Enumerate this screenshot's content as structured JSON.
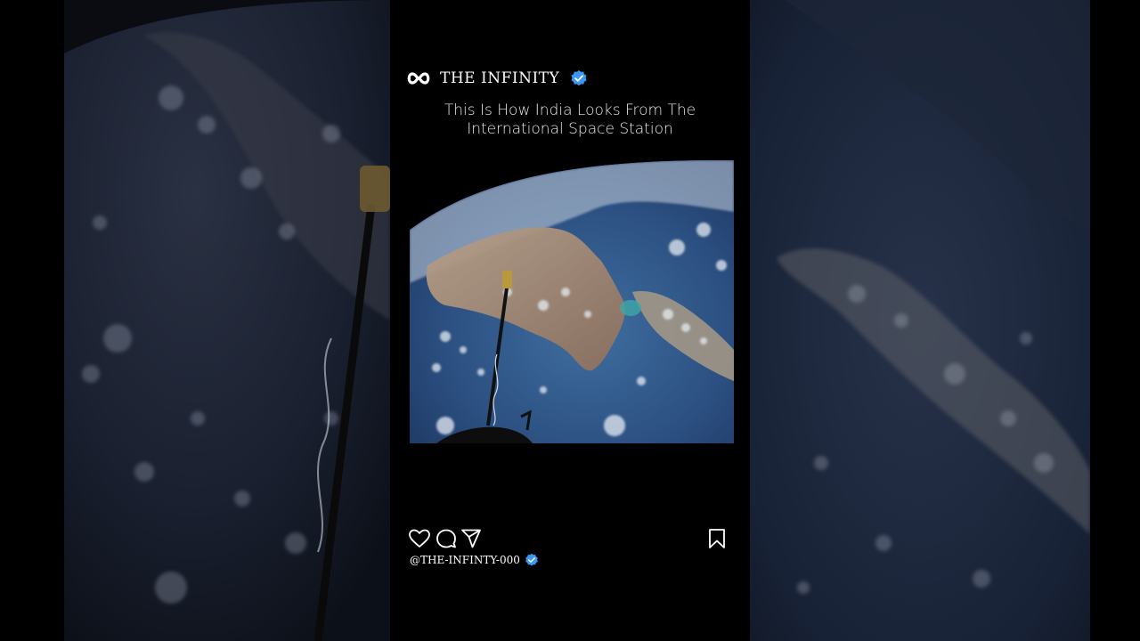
{
  "post": {
    "account_name": "THE INFINITY",
    "caption_line1": "This Is How India Looks From The",
    "caption_line2": "International Space Station",
    "handle": "@THE-INFINTY-000",
    "logo_icon": "infinity-icon",
    "verified_icon": "verified-badge-icon"
  },
  "actions": {
    "like_icon": "heart-icon",
    "comment_icon": "comment-icon",
    "share_icon": "send-icon",
    "save_icon": "bookmark-icon"
  },
  "colors": {
    "background": "#000000",
    "verified": "#3b97f0",
    "text": "#ffffff"
  }
}
